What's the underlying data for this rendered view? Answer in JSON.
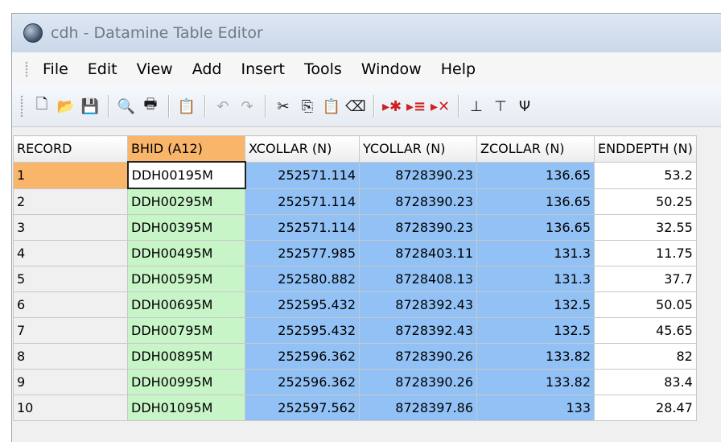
{
  "window": {
    "title": "cdh - Datamine Table Editor"
  },
  "menu": [
    "File",
    "Edit",
    "View",
    "Add",
    "Insert",
    "Tools",
    "Window",
    "Help"
  ],
  "toolbar": {
    "buttons": [
      {
        "name": "new-icon",
        "glyph": "🗋"
      },
      {
        "name": "open-folder-icon",
        "glyph": "📂"
      },
      {
        "name": "save-icon",
        "glyph": "💾"
      },
      {
        "sep": true
      },
      {
        "name": "print-preview-icon",
        "glyph": "🔍"
      },
      {
        "name": "print-icon",
        "glyph": "🖶"
      },
      {
        "sep": true
      },
      {
        "name": "properties-icon",
        "glyph": "📋"
      },
      {
        "sep": true
      },
      {
        "name": "undo-icon",
        "glyph": "↶",
        "disabled": true
      },
      {
        "name": "redo-icon",
        "glyph": "↷",
        "disabled": true
      },
      {
        "sep": true
      },
      {
        "name": "cut-icon",
        "glyph": "✂"
      },
      {
        "name": "copy-icon",
        "glyph": "⎘"
      },
      {
        "name": "paste-icon",
        "glyph": "📋"
      },
      {
        "name": "clear-icon",
        "glyph": "⌫"
      },
      {
        "sep": true
      },
      {
        "name": "insert-record-icon",
        "glyph": "▸✱",
        "red": true
      },
      {
        "name": "append-record-icon",
        "glyph": "▸≡",
        "red": true
      },
      {
        "name": "delete-record-icon",
        "glyph": "▸✕",
        "red": true
      },
      {
        "sep": true
      },
      {
        "name": "insert-field-left-icon",
        "glyph": "⊥"
      },
      {
        "name": "insert-field-right-icon",
        "glyph": "⊤"
      },
      {
        "name": "delete-field-icon",
        "glyph": "Ψ"
      }
    ]
  },
  "table": {
    "columns": [
      "RECORD",
      "BHID (A12)",
      "XCOLLAR (N)",
      "YCOLLAR (N)",
      "ZCOLLAR (N)",
      "ENDDEPTH (N)"
    ],
    "rows": [
      [
        "1",
        "DDH00195M",
        "252571.114",
        "8728390.23",
        "136.65",
        "53.2"
      ],
      [
        "2",
        "DDH00295M",
        "252571.114",
        "8728390.23",
        "136.65",
        "50.25"
      ],
      [
        "3",
        "DDH00395M",
        "252571.114",
        "8728390.23",
        "136.65",
        "32.55"
      ],
      [
        "4",
        "DDH00495M",
        "252577.985",
        "8728403.11",
        "131.3",
        "11.75"
      ],
      [
        "5",
        "DDH00595M",
        "252580.882",
        "8728408.13",
        "131.3",
        "37.7"
      ],
      [
        "6",
        "DDH00695M",
        "252595.432",
        "8728392.43",
        "132.5",
        "50.05"
      ],
      [
        "7",
        "DDH00795M",
        "252595.432",
        "8728392.43",
        "132.5",
        "45.65"
      ],
      [
        "8",
        "DDH00895M",
        "252596.362",
        "8728390.26",
        "133.82",
        "82"
      ],
      [
        "9",
        "DDH00995M",
        "252596.362",
        "8728390.26",
        "133.82",
        "83.4"
      ],
      [
        "10",
        "DDH01095M",
        "252597.562",
        "8728397.86",
        "133",
        "28.47"
      ]
    ]
  }
}
